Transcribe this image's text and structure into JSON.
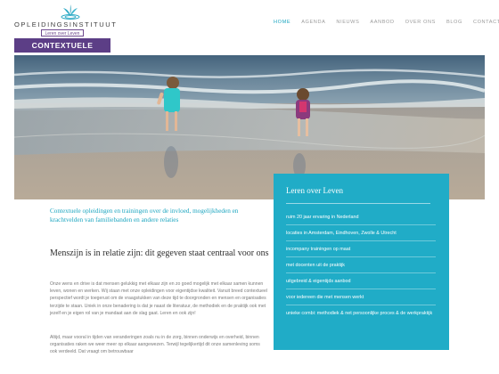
{
  "logo": {
    "name": "OPLEIDINGSINSTITUUT",
    "tagline": "Leren over Leven",
    "brand": "CONTEXTUELE STUDIES"
  },
  "nav": {
    "items": [
      "HOME",
      "AGENDA",
      "NIEUWS",
      "AANBOD",
      "OVER ONS",
      "BLOG",
      "CONTACT"
    ],
    "active": "HOME"
  },
  "hero": {
    "alt": ""
  },
  "main": {
    "intro": "Contextuele opleidingen en trainingen over de invloed, mogelijkheden en krachtvelden van familiebanden en andere relaties",
    "subhead": "Menszijn is in relatie zijn: dit gegeven staat centraal voor ons",
    "p1": "Onze wens en drive is dat mensen gelukkig met elkaar zijn en zo goed mogelijk met elkaar samen kunnen leven, wonen en werken. Wij staan met onze opleidingen voor eigentijdse kwaliteit. Vanuit breed contextueel perspectief wordt je toegerust om de vraagstukken van deze tijd te doorgronden en mensen en organisaties terzijde te staan. Uniek in onze benadering is dat je naast de literatuur, de methodiek en de praktijk ook met jezelf en je eigen rol van je mandaat aan de slag gaat. Leren en ook zijn!",
    "p2": "Altijd, maar vooral in tijden van veranderingen zoals nu in de zorg, binnen onderwijs en overheid, binnen organisaties raken we weer meer op elkaar aangewezen. Terwijl tegelijkertijd dit onze samenleving soms ook verdeeld. Dat vraagt om betrouwbaar"
  },
  "sidebar": {
    "title": "Leren over Leven",
    "items": [
      "ruim 20 jaar ervaring in Nederland",
      "locaties in Amsterdam, Eindhoven, Zwolle & Utrecht",
      "incompany trainingen op maat",
      "met docenten uit de praktijk",
      "uitgebreid & eigentijds aanbod",
      "voor iedereen die met mensen werkt",
      "unieke combi: methodiek & net persoonlijke proces & de werkpraktijk"
    ]
  },
  "colors": {
    "accent": "#20acc7",
    "brand": "#5c3e86"
  }
}
